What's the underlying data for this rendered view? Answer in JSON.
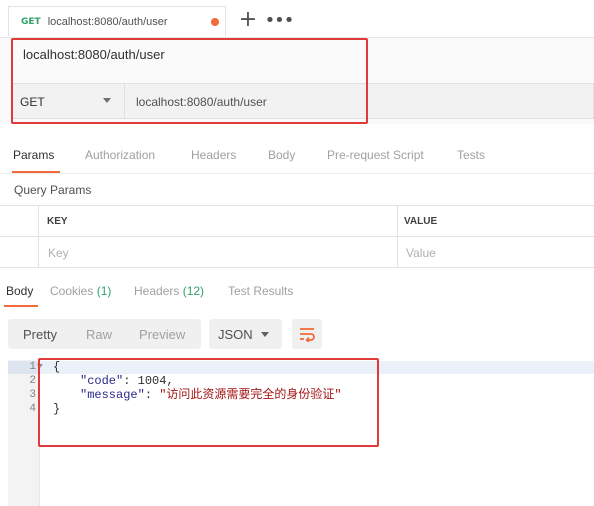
{
  "tab": {
    "method": "GET",
    "label": "localhost:8080/auth/user",
    "unsaved": true
  },
  "request": {
    "name": "localhost:8080/auth/user",
    "method": "GET",
    "url": "localhost:8080/auth/user"
  },
  "request_tabs": [
    "Params",
    "Authorization",
    "Headers",
    "Body",
    "Pre-request Script",
    "Tests"
  ],
  "query_params": {
    "title": "Query Params",
    "columns": [
      "KEY",
      "VALUE"
    ],
    "placeholders": {
      "key": "Key",
      "value": "Value"
    }
  },
  "response_tabs": {
    "body": "Body",
    "cookies": "Cookies",
    "cookies_count": "(1)",
    "headers": "Headers",
    "headers_count": "(12)",
    "test_results": "Test Results"
  },
  "view_modes": [
    "Pretty",
    "Raw",
    "Preview"
  ],
  "format": "JSON",
  "response_code": {
    "line_numbers": [
      "1",
      "2",
      "3",
      "4"
    ],
    "open_brace": "{",
    "close_brace": "}",
    "code_key": "\"code\"",
    "code_value": "1004",
    "message_key": "\"message\"",
    "message_value": "\"访问此资源需要完全的身份验证\""
  },
  "colors": {
    "accent": "#f26b3a",
    "method_get": "#2fa36b",
    "highlight": "#e03a3a"
  }
}
